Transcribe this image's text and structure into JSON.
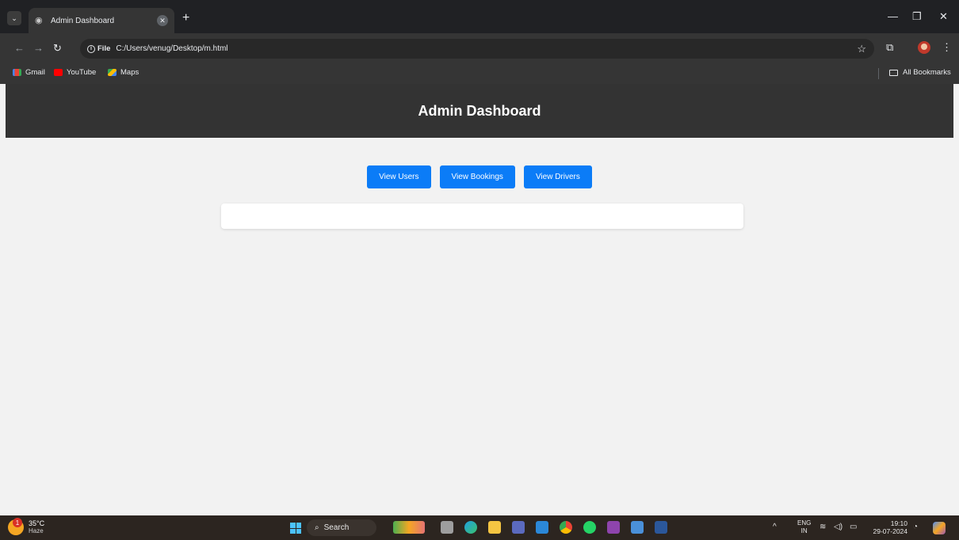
{
  "browser": {
    "tab_title": "Admin Dashboard",
    "chip_label": "File",
    "url": "C:/Users/venug/Desktop/m.html",
    "bookmarks": [
      "Gmail",
      "YouTube",
      "Maps"
    ],
    "all_bookmarks": "All Bookmarks"
  },
  "page": {
    "title": "Admin Dashboard",
    "buttons": [
      "View Users",
      "View Bookings",
      "View Drivers"
    ],
    "colors": {
      "header_bg": "#333333",
      "button_bg": "#0b7cf7",
      "body_bg": "#f2f2f2"
    }
  },
  "taskbar": {
    "weather_temp": "35°C",
    "weather_desc": "Haze",
    "weather_badge": "1",
    "search_label": "Search",
    "lang_top": "ENG",
    "lang_bottom": "IN",
    "time": "19:10",
    "date": "29-07-2024"
  }
}
